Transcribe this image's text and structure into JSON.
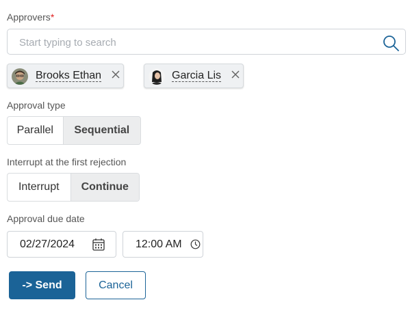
{
  "approvers": {
    "label": "Approvers",
    "required_mark": "*",
    "search_placeholder": "Start typing to search",
    "chips": [
      {
        "name": "Brooks Ethan"
      },
      {
        "name": "Garcia Lis"
      }
    ]
  },
  "approval_type": {
    "label": "Approval type",
    "options": [
      "Parallel",
      "Sequential"
    ],
    "selected": "Sequential"
  },
  "interrupt": {
    "label": "Interrupt at the first rejection",
    "options": [
      "Interrupt",
      "Continue"
    ],
    "selected": "Continue"
  },
  "due_date": {
    "label": "Approval due date",
    "date": "02/27/2024",
    "time": "12:00 AM"
  },
  "actions": {
    "send": "-> Send",
    "cancel": "Cancel"
  },
  "colors": {
    "primary": "#1b6397",
    "required": "#e02020"
  }
}
